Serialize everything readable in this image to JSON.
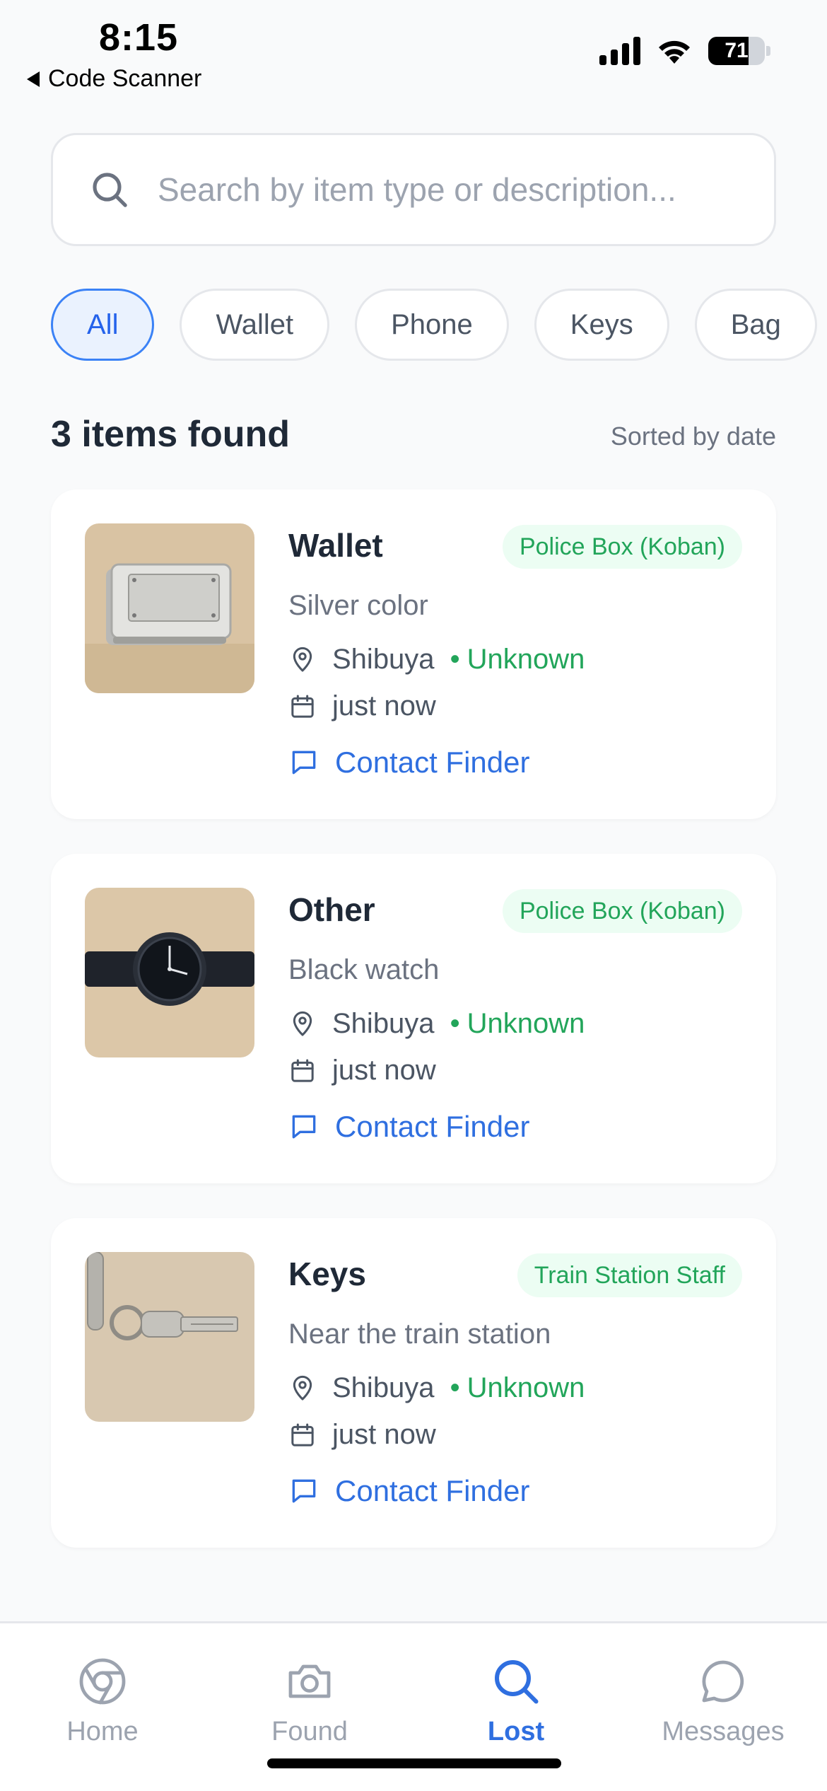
{
  "status_bar": {
    "time": "8:15",
    "back_app": "Code Scanner",
    "battery_level": "71"
  },
  "search": {
    "placeholder": "Search by item type or description...",
    "value": "",
    "icon": "search-icon"
  },
  "filters": {
    "chips": [
      "All",
      "Wallet",
      "Phone",
      "Keys",
      "Bag"
    ],
    "selected": "All"
  },
  "results": {
    "count_label": "3 items found",
    "sort_label": "Sorted by date"
  },
  "items": [
    {
      "title": "Wallet",
      "badge": "Police Box (Koban)",
      "description": "Silver color",
      "location": "Shibuya",
      "status": "Unknown",
      "date": "just now",
      "action": "Contact Finder"
    },
    {
      "title": "Other",
      "badge": "Police Box (Koban)",
      "description": "Black watch",
      "location": "Shibuya",
      "status": "Unknown",
      "date": "just now",
      "action": "Contact Finder"
    },
    {
      "title": "Keys",
      "badge": "Train Station Staff",
      "description": "Near the train station",
      "location": "Shibuya",
      "status": "Unknown",
      "date": "just now",
      "action": "Contact Finder"
    }
  ],
  "nav": {
    "items": [
      {
        "label": "Home",
        "icon": "chrome-icon"
      },
      {
        "label": "Found",
        "icon": "camera-icon"
      },
      {
        "label": "Lost",
        "icon": "search-icon"
      },
      {
        "label": "Messages",
        "icon": "message-circle-icon"
      }
    ],
    "active": "Lost"
  },
  "colors": {
    "accent": "#2f6fe0",
    "badge_green": "#22a55a",
    "badge_bg": "#ecfdf3",
    "chip_active_bg": "#eaf2fe",
    "background": "#f9fafb"
  }
}
